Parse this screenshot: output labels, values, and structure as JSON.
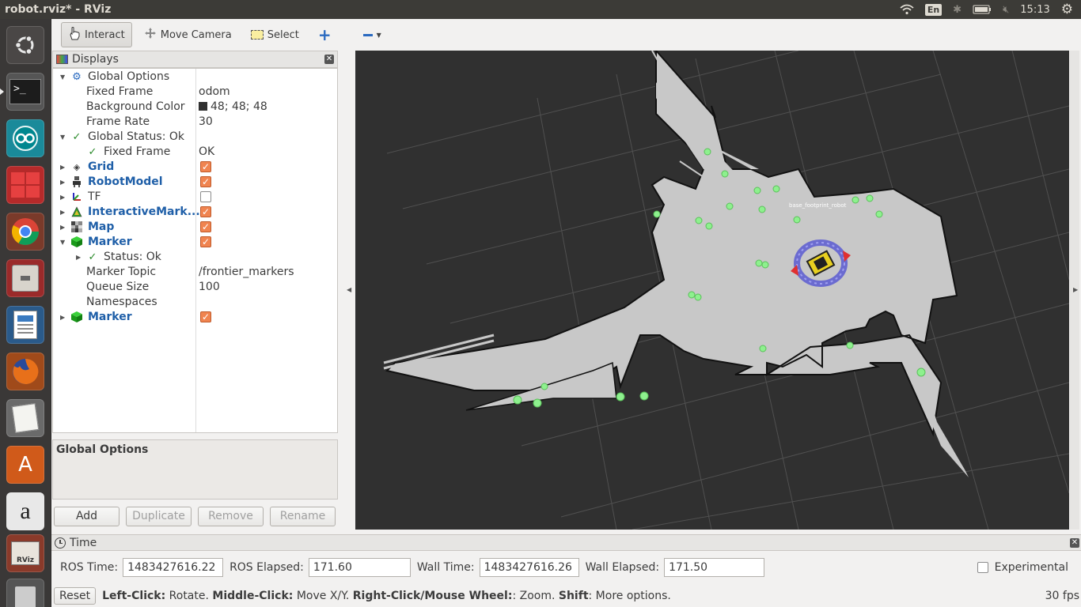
{
  "window": {
    "title": "robot.rviz* - RViz"
  },
  "tray": {
    "keyboard": "En",
    "clock": "15:13"
  },
  "launcher": [
    "ubuntu-dash",
    "terminal",
    "arduino",
    "workspaces",
    "chrome",
    "files",
    "libreoffice-writer",
    "firefox",
    "text-editor",
    "software-center",
    "amazon",
    "rviz",
    "trash"
  ],
  "toolbar": {
    "interact": "Interact",
    "move_camera": "Move Camera",
    "select": "Select"
  },
  "displays": {
    "title": "Displays",
    "rows": [
      {
        "label": "Global Options"
      },
      {
        "label": "Fixed Frame",
        "value": "odom"
      },
      {
        "label": "Background Color",
        "value": "48; 48; 48"
      },
      {
        "label": "Frame Rate",
        "value": "30"
      },
      {
        "label": "Global Status: Ok"
      },
      {
        "label": "Fixed Frame",
        "value": "OK"
      },
      {
        "label": "Grid",
        "checked": true
      },
      {
        "label": "RobotModel",
        "checked": true
      },
      {
        "label": "TF",
        "checked": false
      },
      {
        "label": "InteractiveMark...",
        "checked": true
      },
      {
        "label": "Map",
        "checked": true
      },
      {
        "label": "Marker",
        "checked": true
      },
      {
        "label": "Status: Ok"
      },
      {
        "label": "Marker Topic",
        "value": "/frontier_markers"
      },
      {
        "label": "Queue Size",
        "value": "100"
      },
      {
        "label": "Namespaces"
      },
      {
        "label": "Marker",
        "checked": true
      }
    ],
    "description": "Global Options",
    "buttons": {
      "add": "Add",
      "duplicate": "Duplicate",
      "remove": "Remove",
      "rename": "Rename"
    }
  },
  "view": {
    "background": "#303030",
    "robot_label": "base_footprint_robot"
  },
  "time": {
    "title": "Time",
    "ros_time_label": "ROS Time:",
    "ros_time": "1483427616.22",
    "ros_elapsed_label": "ROS Elapsed:",
    "ros_elapsed": "171.60",
    "wall_time_label": "Wall Time:",
    "wall_time": "1483427616.26",
    "wall_elapsed_label": "Wall Elapsed:",
    "wall_elapsed": "171.50",
    "experimental": "Experimental"
  },
  "status": {
    "reset": "Reset",
    "left_click": "Left-Click:",
    "left_click_desc": "Rotate.",
    "middle_click": "Middle-Click:",
    "middle_click_desc": "Move X/Y.",
    "right_click": "Right-Click/Mouse Wheel:",
    "right_click_desc": ": Zoom.",
    "shift": "Shift",
    "shift_desc": ": More options.",
    "fps": "30 fps"
  }
}
